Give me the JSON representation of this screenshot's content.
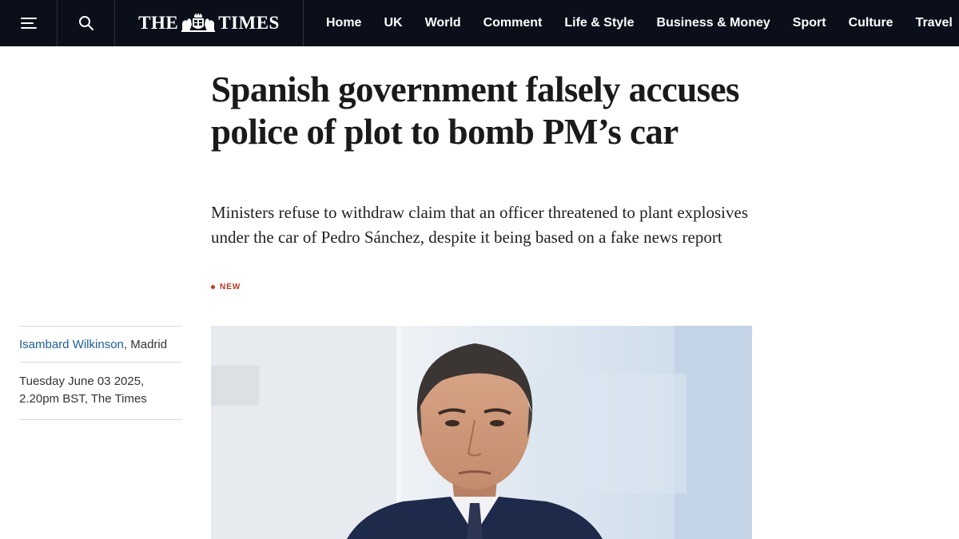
{
  "header": {
    "menu_icon": "menu-icon",
    "search_icon": "search-icon",
    "logo": {
      "left_text": "THE",
      "right_text": "TIMES",
      "crest_icon": "royal-crest-icon"
    },
    "nav": [
      "Home",
      "UK",
      "World",
      "Comment",
      "Life & Style",
      "Business & Money",
      "Sport",
      "Culture",
      "Travel"
    ]
  },
  "article": {
    "headline": "Spanish government falsely accuses police of plot to bomb PM’s car",
    "standfirst": "Ministers refuse to withdraw claim that an officer threatened to plant explosives under the car of Pedro Sánchez, despite it being based on a fake news report",
    "flag": "NEW",
    "author": "Isambard Wilkinson",
    "location": ", Madrid",
    "date_line1": "Tuesday June 03 2025,",
    "date_line2": "2.20pm BST, The Times"
  },
  "colors": {
    "topbar": "#0a0f1a",
    "author_link": "#1c5e9e",
    "flag": "#c8331a"
  }
}
